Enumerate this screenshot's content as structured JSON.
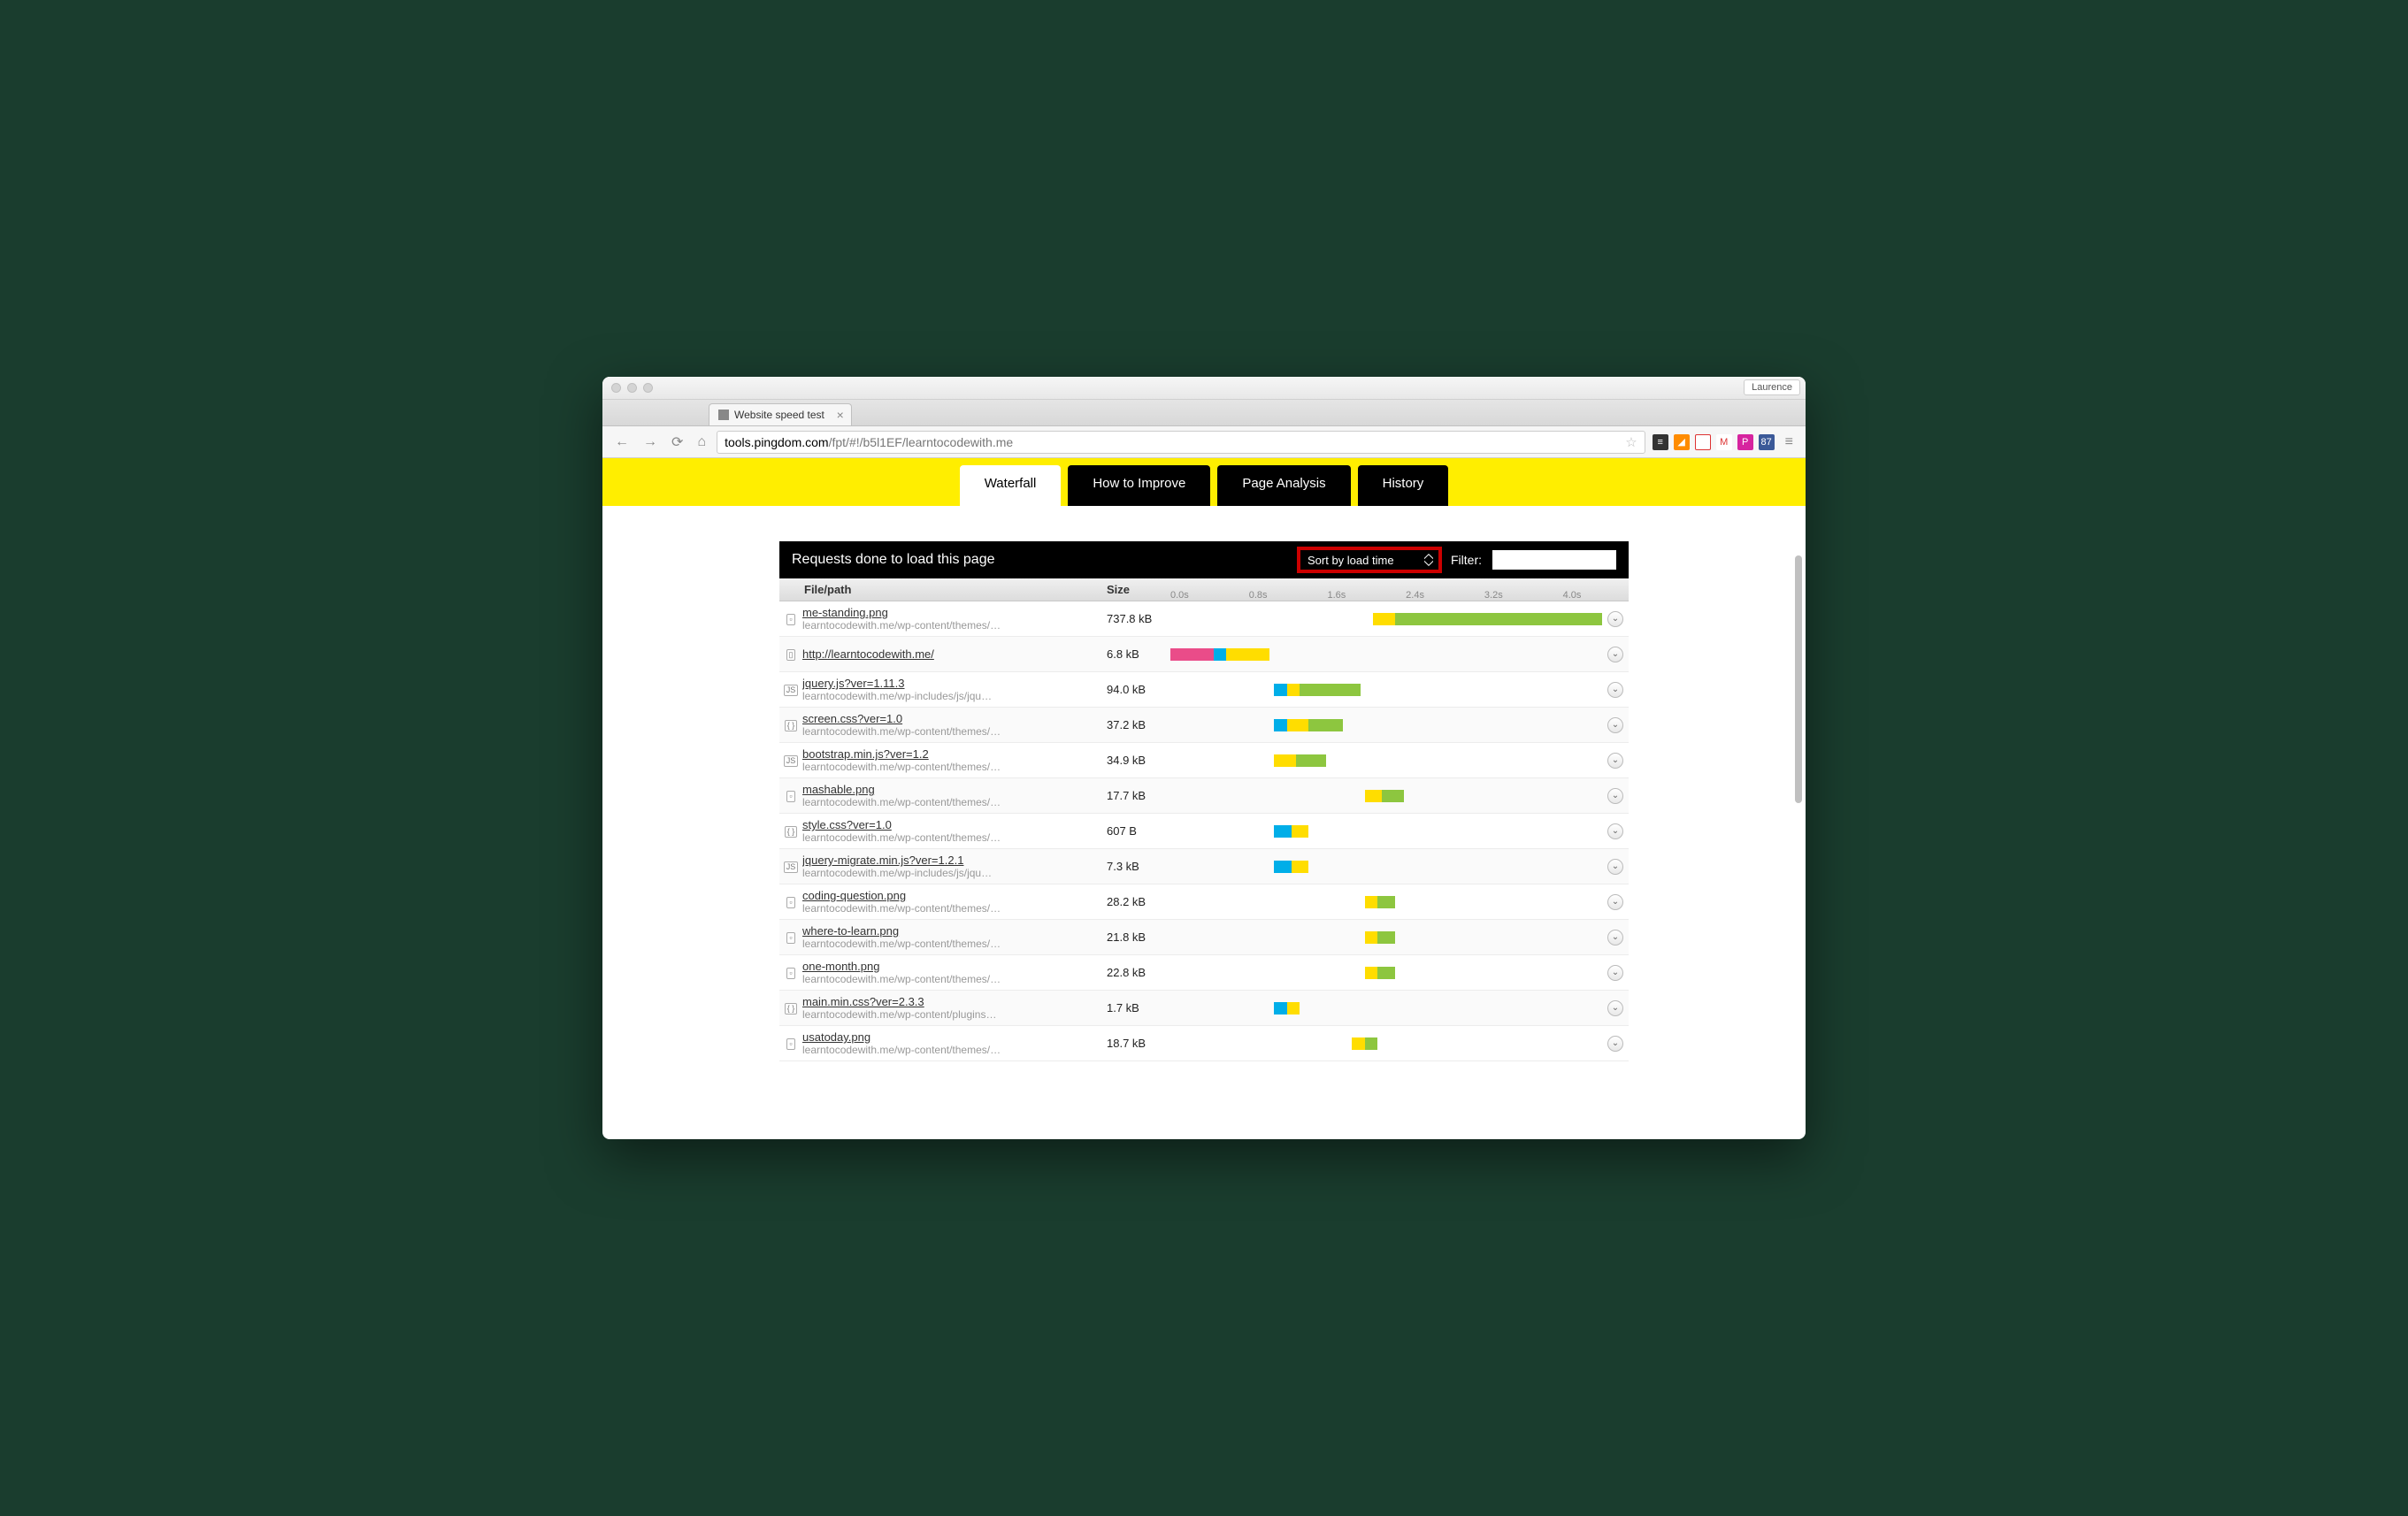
{
  "browser": {
    "profile_name": "Laurence",
    "tab_title": "Website speed test",
    "url_host": "tools.pingdom.com",
    "url_path": "/fpt/#!/b5l1EF/learntocodewith.me"
  },
  "nav_tabs": [
    {
      "label": "Waterfall",
      "active": true
    },
    {
      "label": "How to Improve",
      "active": false
    },
    {
      "label": "Page Analysis",
      "active": false
    },
    {
      "label": "History",
      "active": false
    }
  ],
  "panel": {
    "title": "Requests done to load this page",
    "sort_label": "Sort by load time",
    "filter_label": "Filter:",
    "col_file": "File/path",
    "col_size": "Size",
    "ticks": [
      "0.0s",
      "0.8s",
      "1.6s",
      "2.4s",
      "3.2s",
      "4.0s"
    ]
  },
  "requests": [
    {
      "icon": "img",
      "name": "me-standing.png",
      "path": "learntocodewith.me/wp-content/themes/…",
      "size": "737.8 kB",
      "bar": {
        "start": 47,
        "segs": [
          {
            "c": "yellow",
            "w": 5
          },
          {
            "c": "green",
            "w": 48
          }
        ]
      }
    },
    {
      "icon": "doc",
      "name": "http://learntocodewith.me/",
      "path": "",
      "size": "6.8 kB",
      "bar": {
        "start": 0,
        "segs": [
          {
            "c": "pink",
            "w": 10
          },
          {
            "c": "blue",
            "w": 3
          },
          {
            "c": "yellow",
            "w": 10
          }
        ]
      }
    },
    {
      "icon": "js",
      "name": "jquery.js?ver=1.11.3",
      "path": "learntocodewith.me/wp-includes/js/jqu…",
      "size": "94.0 kB",
      "bar": {
        "start": 24,
        "segs": [
          {
            "c": "blue",
            "w": 3
          },
          {
            "c": "yellow",
            "w": 3
          },
          {
            "c": "green",
            "w": 14
          }
        ]
      }
    },
    {
      "icon": "css",
      "name": "screen.css?ver=1.0",
      "path": "learntocodewith.me/wp-content/themes/…",
      "size": "37.2 kB",
      "bar": {
        "start": 24,
        "segs": [
          {
            "c": "blue",
            "w": 3
          },
          {
            "c": "yellow",
            "w": 5
          },
          {
            "c": "green",
            "w": 8
          }
        ]
      }
    },
    {
      "icon": "js",
      "name": "bootstrap.min.js?ver=1.2",
      "path": "learntocodewith.me/wp-content/themes/…",
      "size": "34.9 kB",
      "bar": {
        "start": 24,
        "segs": [
          {
            "c": "yellow",
            "w": 5
          },
          {
            "c": "green",
            "w": 7
          }
        ]
      }
    },
    {
      "icon": "img",
      "name": "mashable.png",
      "path": "learntocodewith.me/wp-content/themes/…",
      "size": "17.7 kB",
      "bar": {
        "start": 45,
        "segs": [
          {
            "c": "yellow",
            "w": 4
          },
          {
            "c": "green",
            "w": 5
          }
        ]
      }
    },
    {
      "icon": "css",
      "name": "style.css?ver=1.0",
      "path": "learntocodewith.me/wp-content/themes/…",
      "size": "607 B",
      "bar": {
        "start": 24,
        "segs": [
          {
            "c": "blue",
            "w": 4
          },
          {
            "c": "yellow",
            "w": 4
          }
        ]
      }
    },
    {
      "icon": "js",
      "name": "jquery-migrate.min.js?ver=1.2.1",
      "path": "learntocodewith.me/wp-includes/js/jqu…",
      "size": "7.3 kB",
      "bar": {
        "start": 24,
        "segs": [
          {
            "c": "blue",
            "w": 4
          },
          {
            "c": "yellow",
            "w": 4
          }
        ]
      }
    },
    {
      "icon": "img",
      "name": "coding-question.png",
      "path": "learntocodewith.me/wp-content/themes/…",
      "size": "28.2 kB",
      "bar": {
        "start": 45,
        "segs": [
          {
            "c": "yellow",
            "w": 3
          },
          {
            "c": "green",
            "w": 4
          }
        ]
      }
    },
    {
      "icon": "img",
      "name": "where-to-learn.png",
      "path": "learntocodewith.me/wp-content/themes/…",
      "size": "21.8 kB",
      "bar": {
        "start": 45,
        "segs": [
          {
            "c": "yellow",
            "w": 3
          },
          {
            "c": "green",
            "w": 4
          }
        ]
      }
    },
    {
      "icon": "img",
      "name": "one-month.png",
      "path": "learntocodewith.me/wp-content/themes/…",
      "size": "22.8 kB",
      "bar": {
        "start": 45,
        "segs": [
          {
            "c": "yellow",
            "w": 3
          },
          {
            "c": "green",
            "w": 4
          }
        ]
      }
    },
    {
      "icon": "css",
      "name": "main.min.css?ver=2.3.3",
      "path": "learntocodewith.me/wp-content/plugins…",
      "size": "1.7 kB",
      "bar": {
        "start": 24,
        "segs": [
          {
            "c": "blue",
            "w": 3
          },
          {
            "c": "yellow",
            "w": 3
          }
        ]
      }
    },
    {
      "icon": "img",
      "name": "usatoday.png",
      "path": "learntocodewith.me/wp-content/themes/…",
      "size": "18.7 kB",
      "bar": {
        "start": 42,
        "segs": [
          {
            "c": "yellow",
            "w": 3
          },
          {
            "c": "green",
            "w": 3
          }
        ]
      }
    }
  ],
  "ext_icons": [
    {
      "bg": "#333",
      "txt": "≡"
    },
    {
      "bg": "#ff8c00",
      "txt": "◢"
    },
    {
      "bg": "#fff",
      "txt": "◔",
      "border": "#d33"
    },
    {
      "bg": "#fff",
      "txt": "M",
      "color": "#d33"
    },
    {
      "bg": "#d6249f",
      "txt": "P"
    },
    {
      "bg": "#3b5998",
      "txt": "87"
    }
  ]
}
